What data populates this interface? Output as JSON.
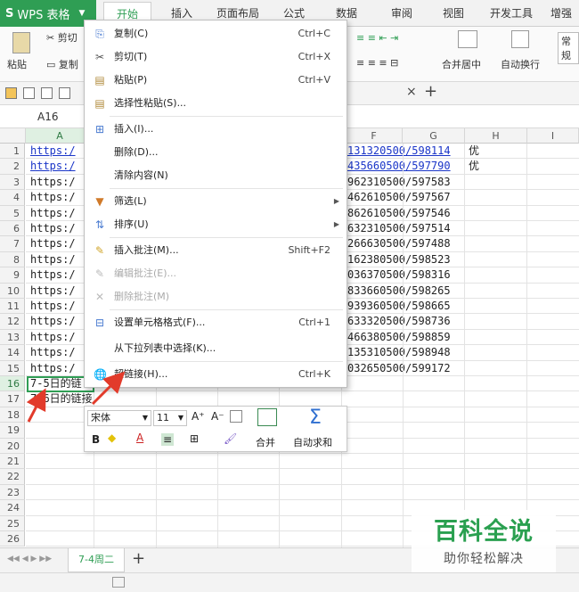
{
  "app": {
    "name": "WPS 表格"
  },
  "menu_tabs": [
    "开始",
    "插入",
    "页面布局",
    "公式",
    "数据",
    "审阅",
    "视图",
    "开发工具",
    "增强盒"
  ],
  "ribbon": {
    "cut": "剪切",
    "paste": "粘贴",
    "copy": "复制",
    "merge_center": "合并居中",
    "wrap_text": "自动换行",
    "number_format": "常规"
  },
  "name_box": "A16",
  "columns": [
    "A",
    "F",
    "G",
    "H",
    "I"
  ],
  "rows": [
    "1",
    "2",
    "3",
    "4",
    "5",
    "6",
    "7",
    "8",
    "9",
    "10",
    "11",
    "12",
    "13",
    "14",
    "15",
    "16",
    "17",
    "18",
    "19",
    "20",
    "21",
    "22",
    "23",
    "24",
    "25",
    "26"
  ],
  "cells_a": [
    "https:/",
    "https:/",
    "https:/",
    "https:/",
    "https:/",
    "https:/",
    "https:/",
    "https:/",
    "https:/",
    "https:/",
    "https:/",
    "https:/",
    "https:/",
    "https:/",
    "https:/",
    "7-5日的链",
    "7-6日的链接"
  ],
  "cells_fg": [
    "131320500/598114",
    "435660500/597790",
    "962310500/597583",
    "462610500/597567",
    "862610500/597546",
    "632310500/597514",
    "266630500/597488",
    "162380500/598523",
    "036370500/598316",
    "833660500/598265",
    "939360500/598665",
    "633320500/598736",
    "466380500/598859",
    "135310500/598948",
    "032650500/599172"
  ],
  "cells_h": [
    "优",
    "优"
  ],
  "context_menu": {
    "items": [
      {
        "label": "复制(C)",
        "shortcut": "Ctrl+C",
        "icon": "copy-icon"
      },
      {
        "label": "剪切(T)",
        "shortcut": "Ctrl+X",
        "icon": "scissors-icon"
      },
      {
        "label": "粘贴(P)",
        "shortcut": "Ctrl+V",
        "icon": "paste-icon"
      },
      {
        "label": "选择性粘贴(S)...",
        "shortcut": "",
        "icon": "paste-special-icon"
      },
      {
        "label": "插入(I)...",
        "shortcut": "",
        "icon": "insert-icon"
      },
      {
        "label": "删除(D)...",
        "shortcut": "",
        "icon": ""
      },
      {
        "label": "清除内容(N)",
        "shortcut": "",
        "icon": ""
      },
      {
        "label": "筛选(L)",
        "shortcut": "",
        "icon": "filter-icon"
      },
      {
        "label": "排序(U)",
        "shortcut": "",
        "icon": "sort-icon"
      },
      {
        "label": "插入批注(M)...",
        "shortcut": "Shift+F2",
        "icon": "comment-insert-icon"
      },
      {
        "label": "编辑批注(E)...",
        "shortcut": "",
        "icon": "comment-edit-icon"
      },
      {
        "label": "删除批注(M)",
        "shortcut": "",
        "icon": "comment-delete-icon"
      },
      {
        "label": "设置单元格格式(F)...",
        "shortcut": "Ctrl+1",
        "icon": "format-cells-icon"
      },
      {
        "label": "从下拉列表中选择(K)...",
        "shortcut": "",
        "icon": ""
      },
      {
        "label": "超链接(H)...",
        "shortcut": "Ctrl+K",
        "icon": "hyperlink-icon"
      }
    ]
  },
  "mini_toolbar": {
    "font_name": "宋体",
    "font_size": "11",
    "grow_font": "A⁺",
    "shrink_font": "A⁻",
    "bold": "B",
    "merge": "合并",
    "autosum": "自动求和"
  },
  "sheet_tab": "7-4周二",
  "watermark": {
    "title": "百科全说",
    "subtitle": "助你轻松解决"
  },
  "colors": {
    "accent": "#2f9e54",
    "link": "#1a35c8",
    "arrow": "#e23b2b"
  }
}
